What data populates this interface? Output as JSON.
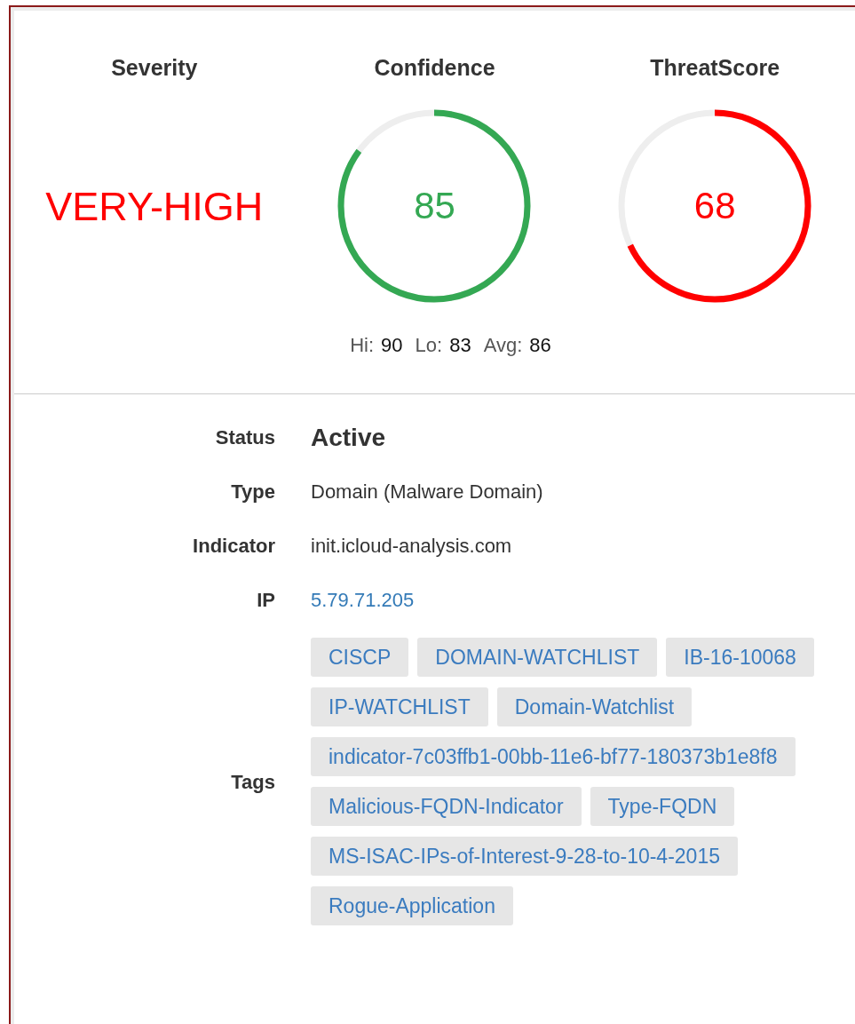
{
  "severity": {
    "title": "Severity",
    "value": "VERY-HIGH"
  },
  "gauges": [
    {
      "title": "Confidence",
      "value": "85",
      "level": 0.85,
      "color": "#34a853"
    },
    {
      "title": "ThreatScore",
      "value": "68",
      "level": 0.68,
      "color": "#ff0000"
    }
  ],
  "stats": [
    {
      "label": "Hi:",
      "value": "90"
    },
    {
      "label": "Lo:",
      "value": "83"
    },
    {
      "label": "Avg:",
      "value": "86"
    }
  ],
  "details": [
    {
      "label": "Status",
      "value": "Active",
      "kind": "status"
    },
    {
      "label": "Type",
      "value": "Domain (Malware Domain)",
      "kind": "text"
    },
    {
      "label": "Indicator",
      "value": "init.icloud-analysis.com",
      "kind": "text"
    },
    {
      "label": "IP",
      "value": "5.79.71.205",
      "kind": "link"
    }
  ],
  "tags": {
    "label": "Tags",
    "items": [
      "CISCP",
      "DOMAIN-WATCHLIST",
      "IB-16-10068",
      "IP-WATCHLIST",
      "Domain-Watchlist",
      "indicator-7c03ffb1-00bb-11e6-bf77-180373b1e8f8",
      "Malicious-FQDN-Indicator",
      "Type-FQDN",
      "MS-ISAC-IPs-of-Interest-9-28-to-10-4-2015",
      "Rogue-Application"
    ]
  }
}
